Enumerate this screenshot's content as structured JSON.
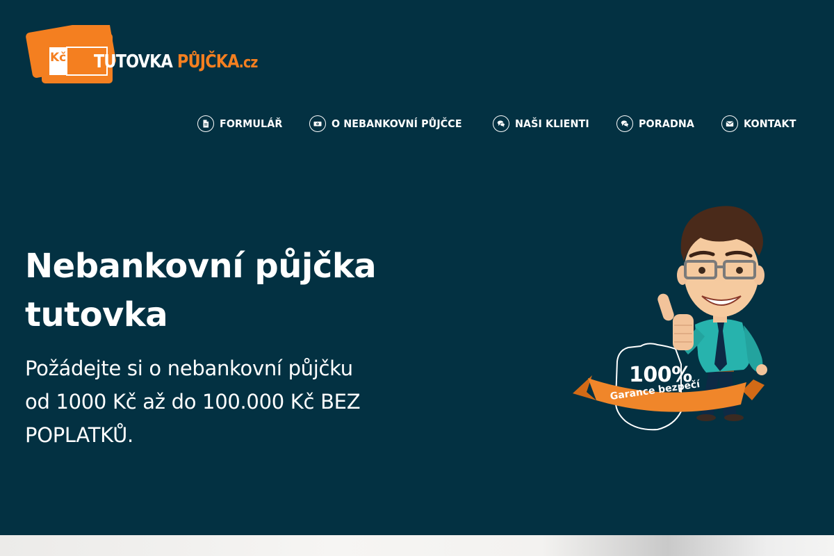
{
  "logo": {
    "badge_text": "Kč",
    "word1": "TUTOVKA ",
    "word2": "PŮJČKA",
    "word3": ".cz"
  },
  "nav": {
    "items": [
      {
        "label": "FORMULÁŘ",
        "icon": "document-icon"
      },
      {
        "label": "O NEBANKOVNÍ PŮJČCE",
        "icon": "money-icon"
      },
      {
        "label": "NAŠI KLIENTI",
        "icon": "chat-icon"
      },
      {
        "label": "PORADNA",
        "icon": "chat-icon"
      },
      {
        "label": "KONTAKT",
        "icon": "envelope-icon"
      }
    ]
  },
  "hero": {
    "title_line1": "Nebankovní půjčka",
    "title_line2": "tutovka",
    "subtitle": "Požádejte si o nebankovní půjčku od 1000 Kč až do 100.000 Kč BEZ POPLATKŮ."
  },
  "badge": {
    "percent": "100%",
    "text": "Garance bezpečí"
  },
  "colors": {
    "background": "#033142",
    "accent": "#f47f20",
    "text": "#ffffff"
  }
}
